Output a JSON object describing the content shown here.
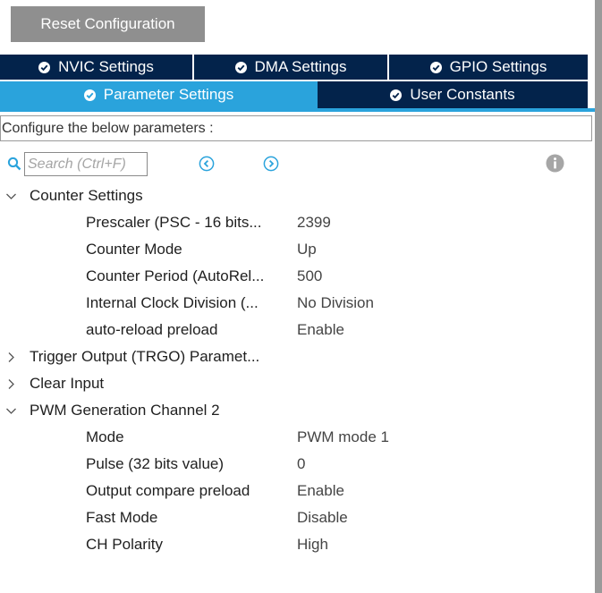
{
  "reset_button": {
    "label": "Reset Configuration"
  },
  "tabs_row1": [
    {
      "label": "NVIC Settings",
      "active": false
    },
    {
      "label": "DMA Settings",
      "active": false
    },
    {
      "label": "GPIO Settings",
      "active": false
    }
  ],
  "tabs_row2": [
    {
      "label": "Parameter Settings",
      "active": true
    },
    {
      "label": "User Constants",
      "active": false
    }
  ],
  "configure_text": "Configure the below parameters :",
  "search": {
    "placeholder": "Search (Ctrl+F)",
    "value": ""
  },
  "groups": [
    {
      "label": "Counter Settings",
      "expanded": true,
      "params": [
        {
          "name": "Prescaler (PSC - 16 bits...",
          "value": "2399"
        },
        {
          "name": "Counter Mode",
          "value": "Up"
        },
        {
          "name": "Counter Period (AutoRel...",
          "value": "500"
        },
        {
          "name": "Internal Clock Division (...",
          "value": "No Division"
        },
        {
          "name": "auto-reload preload",
          "value": "Enable"
        }
      ]
    },
    {
      "label": "Trigger Output (TRGO) Paramet...",
      "expanded": false,
      "params": []
    },
    {
      "label": "Clear Input",
      "expanded": false,
      "params": []
    },
    {
      "label": "PWM Generation Channel 2",
      "expanded": true,
      "params": [
        {
          "name": "Mode",
          "value": "PWM mode 1"
        },
        {
          "name": "Pulse (32 bits value)",
          "value": "0"
        },
        {
          "name": "Output compare preload",
          "value": "Enable"
        },
        {
          "name": "Fast Mode",
          "value": "Disable"
        },
        {
          "name": "CH Polarity",
          "value": "High"
        }
      ]
    }
  ],
  "colors": {
    "tab_dark": "#03234b",
    "tab_active": "#2aa3dc",
    "reset_button_bg": "#8f8f8f",
    "nav_icon": "#2aa3dc"
  },
  "icons": {
    "tab_check": "check-circle-icon",
    "search": "search-icon",
    "previous": "chevron-left-circle-icon",
    "next": "chevron-right-circle-icon",
    "info": "info-icon",
    "expanded": "chevron-down-icon",
    "collapsed": "chevron-right-icon"
  }
}
